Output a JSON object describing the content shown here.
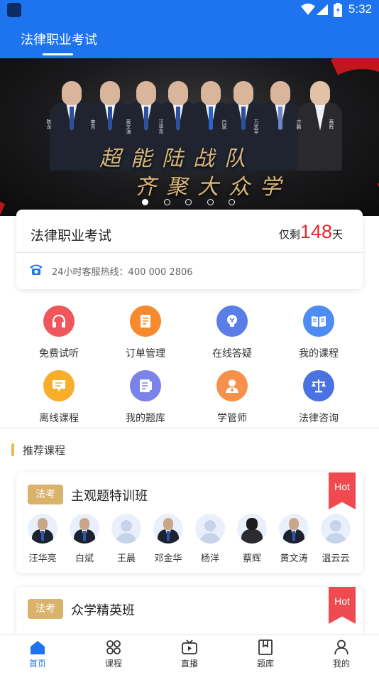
{
  "status_bar": {
    "time": "5:32"
  },
  "header": {
    "tab_title": "法律职业考试"
  },
  "banner": {
    "slogan_line1": "超能陆战队",
    "slogan_line2": "齐聚大众学",
    "person_names": [
      "陈龙",
      "李亮",
      "黄文涛",
      "汪华亮",
      "白斌",
      "万志平",
      "方鹏",
      "蔡辉"
    ],
    "dots": 5,
    "active_dot": 0
  },
  "exam_card": {
    "title": "法律职业考试",
    "days_prefix": "仅剩",
    "days_value": "148",
    "days_suffix": "天",
    "hotline": "24小时客服热线：400 000 2806"
  },
  "quick_menu": [
    {
      "label": "免费试听",
      "icon": "headphones-icon",
      "color": "#f0575c"
    },
    {
      "label": "订单管理",
      "icon": "order-document-icon",
      "color": "#f78a2c"
    },
    {
      "label": "在线答疑",
      "icon": "lightbulb-icon",
      "color": "#5b7de8"
    },
    {
      "label": "我的课程",
      "icon": "open-book-icon",
      "color": "#4d8cf5"
    },
    {
      "label": "离线课程",
      "icon": "offline-chat-icon",
      "color": "#f8ad2b"
    },
    {
      "label": "我的题库",
      "icon": "question-bank-icon",
      "color": "#7b82ea"
    },
    {
      "label": "学管师",
      "icon": "tutor-person-icon",
      "color": "#f6904a"
    },
    {
      "label": "法律咨询",
      "icon": "scales-icon",
      "color": "#4a72e0"
    }
  ],
  "section": {
    "title": "推荐课程"
  },
  "courses": [
    {
      "tag": "法考",
      "name": "主观题特训班",
      "hot": "Hot",
      "teachers": [
        "汪华亮",
        "白斌",
        "王晨",
        "邓金华",
        "杨洋",
        "蔡辉",
        "黄文涛",
        "温云云"
      ]
    },
    {
      "tag": "法考",
      "name": "众学精英班",
      "hot": "Hot"
    }
  ],
  "bottom_nav": [
    {
      "label": "首页",
      "icon": "home-icon",
      "active": true
    },
    {
      "label": "课程",
      "icon": "course-grid-icon",
      "active": false
    },
    {
      "label": "直播",
      "icon": "live-tv-icon",
      "active": false
    },
    {
      "label": "题库",
      "icon": "question-bank-book-icon",
      "active": false
    },
    {
      "label": "我的",
      "icon": "profile-icon",
      "active": false
    }
  ],
  "colors": {
    "primary": "#1e74ef",
    "accent_red": "#e8242b",
    "tag_gold": "#d9b26b",
    "hot_red": "#ef4a4f"
  }
}
